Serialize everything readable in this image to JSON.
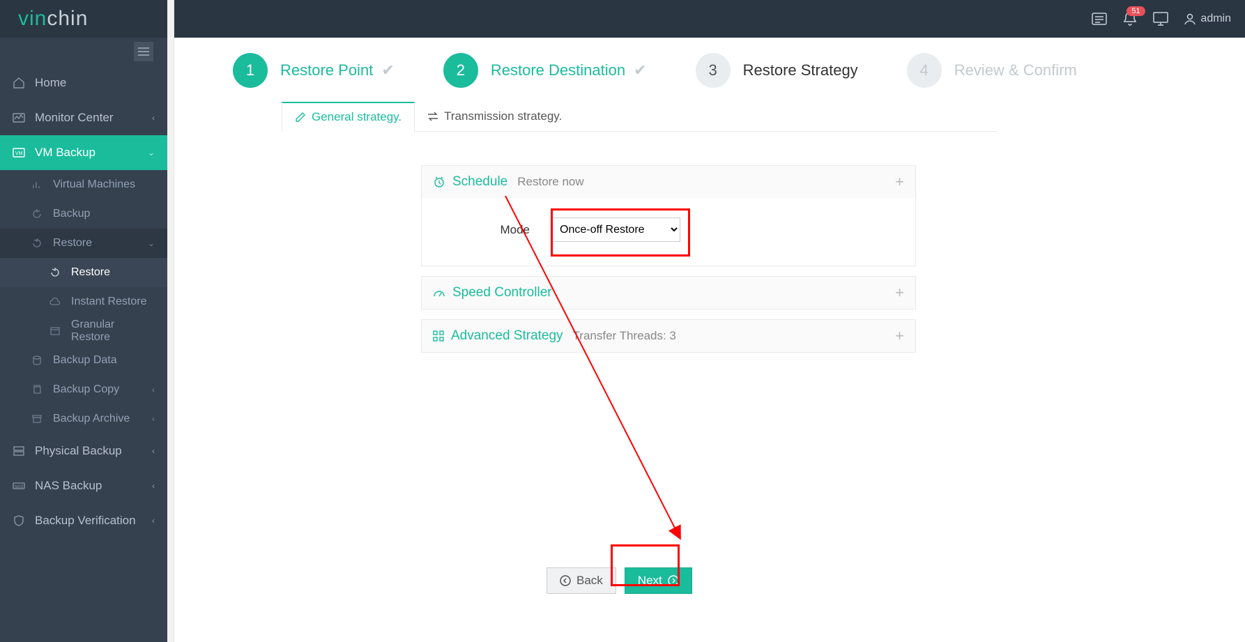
{
  "header": {
    "brand_part1": "vin",
    "brand_part2": "chin",
    "notification_count": "51",
    "username": "admin"
  },
  "sidebar": {
    "home": "Home",
    "monitor_center": "Monitor Center",
    "vm_backup": "VM Backup",
    "virtual_machines": "Virtual Machines",
    "backup": "Backup",
    "restore": "Restore",
    "restore_sub": "Restore",
    "instant_restore": "Instant Restore",
    "granular_restore": "Granular Restore",
    "backup_data": "Backup Data",
    "backup_copy": "Backup Copy",
    "backup_archive": "Backup Archive",
    "physical_backup": "Physical Backup",
    "nas_backup": "NAS Backup",
    "backup_verification": "Backup Verification"
  },
  "wizard": {
    "step1_num": "1",
    "step1_label": "Restore Point",
    "step2_num": "2",
    "step2_label": "Restore Destination",
    "step3_num": "3",
    "step3_label": "Restore Strategy",
    "step4_num": "4",
    "step4_label": "Review & Confirm"
  },
  "tabs": {
    "general": "General strategy.",
    "transmission": "Transmission strategy."
  },
  "panels": {
    "schedule_title": "Schedule",
    "schedule_subtitle": "Restore now",
    "mode_label": "Mode",
    "mode_value": "Once-off Restore",
    "speed_title": "Speed Controller",
    "adv_title": "Advanced Strategy",
    "adv_subtitle": "Transfer Threads: 3"
  },
  "buttons": {
    "back": "Back",
    "next": "Next"
  }
}
